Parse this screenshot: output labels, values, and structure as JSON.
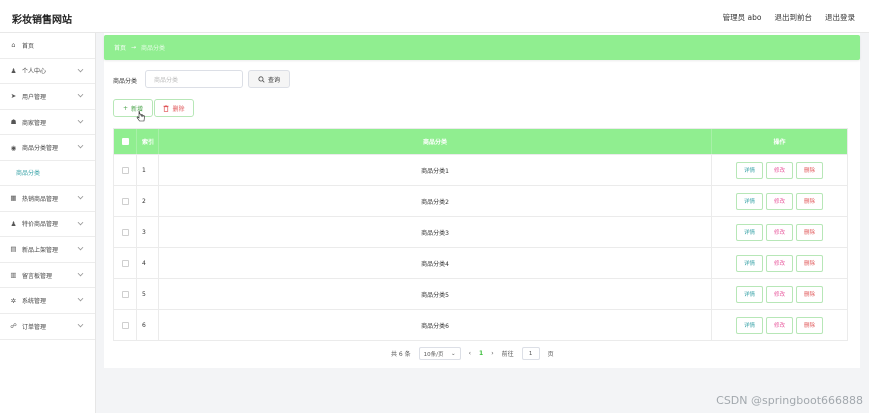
{
  "header": {
    "brand": "彩妆销售网站",
    "admin_label": "管理员 abo",
    "front_label": "退出到前台",
    "logout_label": "退出登录"
  },
  "sidebar": {
    "items": [
      {
        "label": "首页",
        "icon": "home-icon",
        "glyph": "⌂",
        "chevron": false
      },
      {
        "label": "个人中心",
        "icon": "user-icon",
        "glyph": "♟",
        "chevron": true
      },
      {
        "label": "用户管理",
        "icon": "send-icon",
        "glyph": "➤",
        "chevron": true
      },
      {
        "label": "商家管理",
        "icon": "shop-icon",
        "glyph": "☗",
        "chevron": true
      },
      {
        "label": "商品分类管理",
        "icon": "circle-icon",
        "glyph": "◉",
        "chevron": true
      },
      {
        "label": "热销商品管理",
        "icon": "trash-icon",
        "glyph": "▦",
        "chevron": true
      },
      {
        "label": "特价商品管理",
        "icon": "user-icon",
        "glyph": "♟",
        "chevron": true
      },
      {
        "label": "新品上架管理",
        "icon": "document-icon",
        "glyph": "▤",
        "chevron": true
      },
      {
        "label": "留言板管理",
        "icon": "chart-icon",
        "glyph": "▥",
        "chevron": true
      },
      {
        "label": "系统管理",
        "icon": "gear-icon",
        "glyph": "✲",
        "chevron": true
      },
      {
        "label": "订单管理",
        "icon": "order-icon",
        "glyph": "☍",
        "chevron": true
      }
    ],
    "sub_item": "商品分类"
  },
  "breadcrumb": {
    "home": "首页",
    "arrow": "→",
    "current": "商品分类"
  },
  "search": {
    "label": "商品分类",
    "placeholder": "商品分类",
    "button": "查询"
  },
  "actions": {
    "add": "新增",
    "delete": "删除"
  },
  "table": {
    "headers": {
      "index": "索引",
      "name": "商品分类",
      "ops": "操作"
    },
    "rows": [
      {
        "index": "1",
        "name": "商品分类1"
      },
      {
        "index": "2",
        "name": "商品分类2"
      },
      {
        "index": "3",
        "name": "商品分类3"
      },
      {
        "index": "4",
        "name": "商品分类4"
      },
      {
        "index": "5",
        "name": "商品分类5"
      },
      {
        "index": "6",
        "name": "商品分类6"
      }
    ],
    "op_labels": {
      "detail": "详情",
      "edit": "修改",
      "delete": "删除"
    }
  },
  "pagination": {
    "total": "共 6 条",
    "page_size": "10条/页",
    "prev": "‹",
    "current_page": "1",
    "next": "›",
    "goto_label": "前往",
    "goto_value": "1",
    "page_suffix": "页"
  },
  "watermark": "CSDN @springboot666888",
  "colors": {
    "accent": "#90ee90",
    "teal": "#3aa3a8",
    "danger": "#e0585a"
  }
}
